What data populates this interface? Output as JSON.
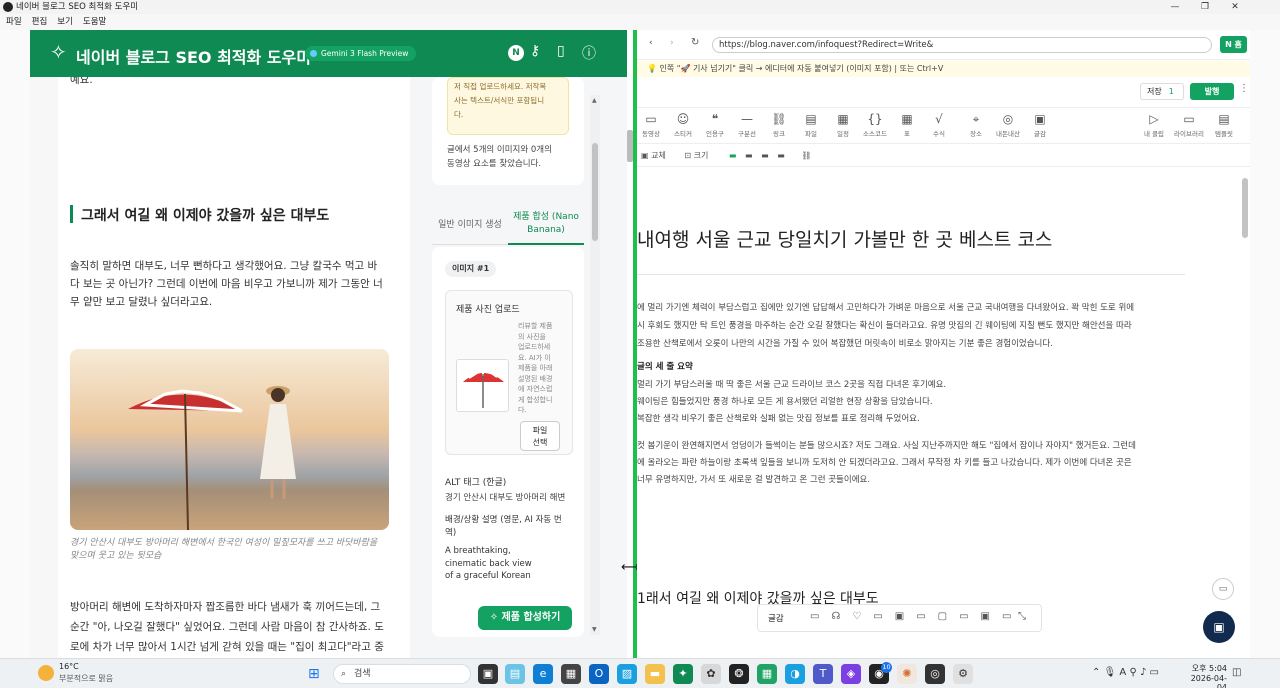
{
  "window": {
    "title": "네이버 블로그 SEO 최적화 도우미",
    "controls": [
      "—",
      "❐",
      "✕"
    ]
  },
  "menu": [
    "파일",
    "편집",
    "보기",
    "도움말"
  ],
  "app": {
    "title": "네이버 블로그 SEO 최적화 도우미",
    "model_badge": "Gemini 3 Flash Preview",
    "user_initial": "N"
  },
  "article": {
    "top_fragment": "예요.",
    "heading": "그래서 여길 왜 이제야 갔을까 싶은 대부도",
    "para1": [
      "솔직히 말하면 대부도, 너무 뻔하다고 생각했어요. 그냥 칼국수 먹고 바",
      "다 보는 곳 아닌가? 그런데 이번에 마음 비우고 가보니까 제가 그동안 너",
      "무 얕만 보고 달렸나 싶더라고요."
    ],
    "caption": [
      "경기 안산시 대부도 방아머리 해변에서 한국인 여성이 밀짚모자를 쓰고 바닷바람을",
      "맞으며 웃고 있는 뒷모습"
    ],
    "para2": [
      "방아머리 해변에 도착하자마자 짭조름한 바다 냄새가 훅 끼어드는데, 그",
      "순간 \"아, 나오길 잘했다\" 싶었어요. 그런데 사람 마음이 참 간사하죠. 도",
      "로에 차가 너무 많아서 1시간 넘게 갇혀 있을 때는 \"집이 최고다\"라고 중"
    ]
  },
  "panel": {
    "notice_lines": [
      "저 직접 업로드하세요. 저작복",
      "사는 텍스트/서식만 포함됩니",
      "다."
    ],
    "found": [
      "글에서 5개의 이미지와 0개의",
      "동영상 요소를 찾았습니다."
    ],
    "tab_general": "일반 이미지 생성",
    "tab_product": [
      "제품 합성 (Nano",
      "Banana)"
    ],
    "image_chip": "이미지 #1",
    "upload_title": "제품 사진 업로드",
    "upload_desc": [
      "리뷰할 제품",
      "의 사진을",
      "업로드하세",
      "요. AI가 이",
      "제품을 아래",
      "설명된 배경",
      "에 자연스럽",
      "게 합성합니",
      "다."
    ],
    "file_btn": [
      "파일",
      "선택"
    ],
    "alt_label": "ALT 태그 (한글)",
    "alt_value": "경기 안산시 대부도 방아머리 해변",
    "bg_label": [
      "배경/상황 설명 (영문, AI 자동 번",
      "역)"
    ],
    "bg_value": [
      "A breathtaking,",
      "cinematic back view",
      "of a graceful Korean"
    ],
    "synth_btn": "제품 합성하기"
  },
  "browser": {
    "url": "https://blog.naver.com/infoquest?Redirect=Write&",
    "n_btn": "N 홈",
    "hint": "💡 인쪽 \"🚀 기사 넘기기\" 클릭 → 에디터에 자동 붙여넣기 (이미지 포함) | 또는 Ctrl+V",
    "save_label": "저장",
    "save_count": "1",
    "publish_label": "발행",
    "tools": [
      "동영상",
      "스티커",
      "인용구",
      "구분선",
      "링크",
      "파일",
      "일정",
      "소스코드",
      "표",
      "수식",
      "장소",
      "내돈내산",
      "글감",
      "내 클립",
      "라이브러리",
      "템플릿"
    ],
    "sub_tools": [
      "교체",
      "크기"
    ],
    "doc_title": "내여행 서울 근교 당일치기 가볼만 한 곳 베스트 코스",
    "p1": [
      "에 멀리 가기엔 체력이 부담스럽고 집에만 있기엔 답답해서 고민하다가 가벼운 마음으로 서울 근교 국내여행을 다녀왔어요. 꽉 막힌 도로 위에",
      "시 후회도 했지만 탁 트인 풍경을 마주하는 순간 오길 잘했다는 확신이 들더라고요. 유명 맛집의 긴 웨이팅에 지칠 뻔도 했지만 해안선을 따라",
      "조용한 산책로에서 오롯이 나만의 시간을 가질 수 있어 복잡했던 머릿속이 비로소 맑아지는 기분 좋은 경험이었습니다."
    ],
    "summary_title": "글의 세 줄 요약",
    "summary": [
      "멀리 가기 부담스러울 때 딱 좋은 서울 근교 드라이브 코스 2곳을 직접 다녀온 후기예요.",
      "웨이팅은 힘들었지만 풍경 하나로 모든 게 용서됐던 리얼한 현장 상황을 담았습니다.",
      "복잡한 생각 비우기 좋은 산책로와 실패 없는 맛집 정보를 표로 정리해 두었어요."
    ],
    "p2": [
      "컷 봄기운이 완연해지면서 엉덩이가 들썩이는 분들 많으시죠? 저도 그래요. 사실 지난주까지만 해도 \"집에서 잠이나 자야지\" 했거든요. 그런데",
      "에 올라오는 파란 하늘이랑 초록색 잎들을 보니까 도저히 안 되겠더라고요. 그래서 무작정 차 키를 들고 나갔습니다. 제가 이번에 다녀온 곳은",
      "너무 유명하지만, 가서 또 새로운 걸 발견하고 온 그런 곳들이에요."
    ],
    "doc_heading2": "1래서 여길 왜 이제야 갔을까 싶은 대부도",
    "bottom_label": "글감"
  },
  "taskbar": {
    "temp": "16°C",
    "weather": "부분적으로 맑음",
    "search": "검색",
    "time": "오후 5:04",
    "date": "2026-04-04",
    "badge": "10"
  },
  "colors": {
    "brand": "#0e8a52",
    "divider": "#1fbf4e",
    "publish": "#14a262"
  }
}
